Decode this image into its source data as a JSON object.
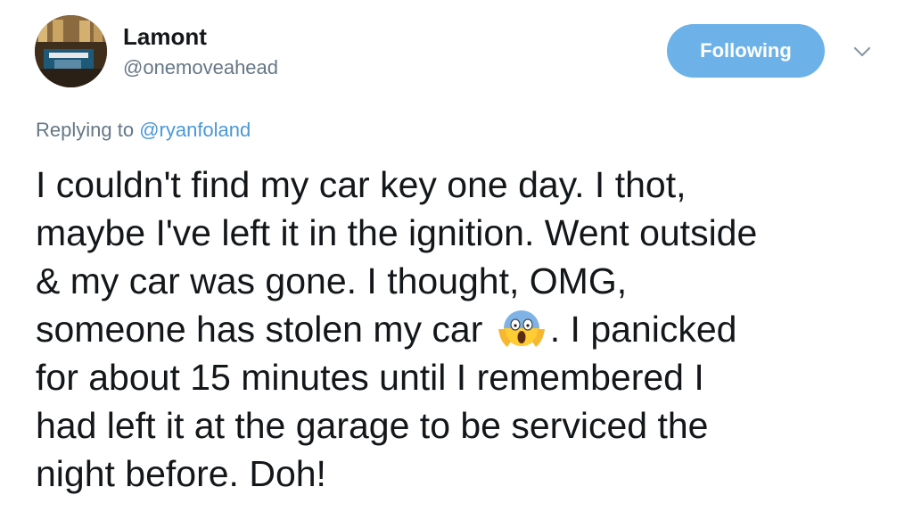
{
  "user": {
    "display_name": "Lamont",
    "handle": "@onemoveahead",
    "avatar_icon": "avatar-photo"
  },
  "actions": {
    "follow_label": "Following",
    "follow_color": "#6cb2e8",
    "menu_icon": "chevron-down-icon"
  },
  "reply": {
    "prefix": "Replying to ",
    "mention": "@ryanfoland",
    "mention_color": "#4a98d6"
  },
  "tweet": {
    "lines": [
      "I couldn't find my car key one day. I thot,",
      "maybe I've left it in the ignition. Went outside",
      "& my car was gone. I thought, OMG,",
      "someone has stolen my car",
      ". I panicked",
      "for about 15 minutes until I remembered I",
      "had left it at the garage to be serviced the",
      "night before. Doh!"
    ],
    "emoji": "screaming-face-emoji"
  }
}
